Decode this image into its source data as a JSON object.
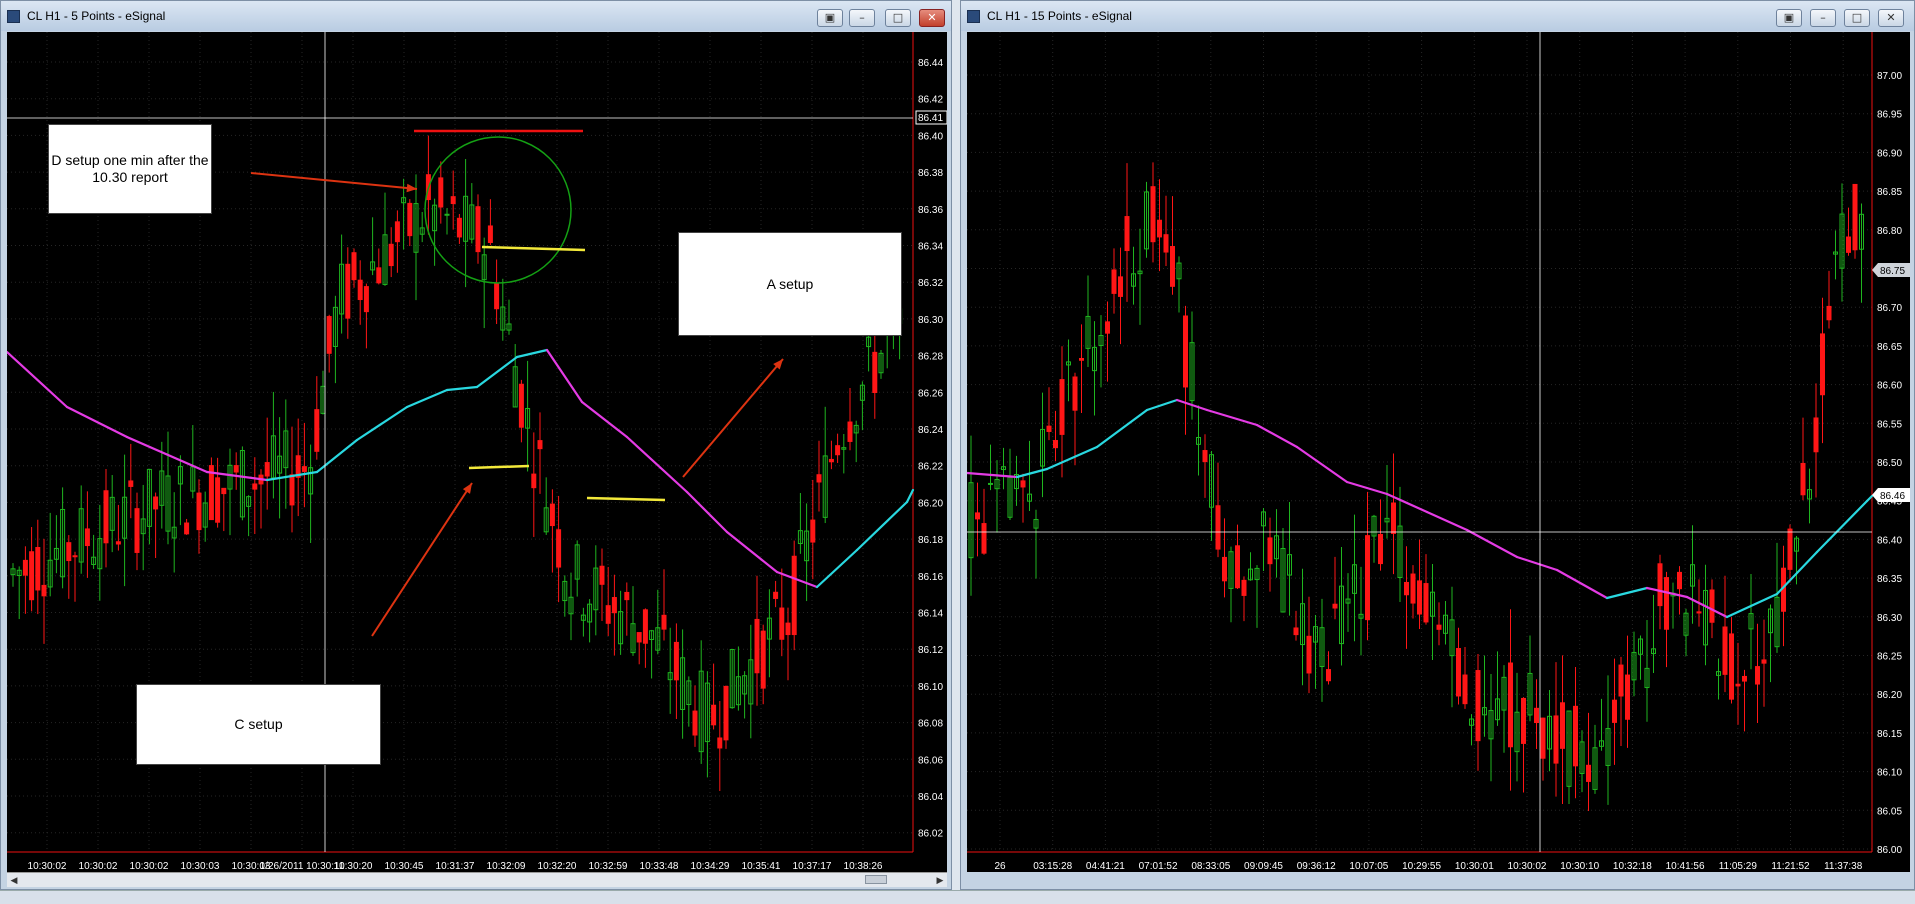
{
  "windows": {
    "left": {
      "title": "CL H1 - 5 Points - eSignal"
    },
    "right": {
      "title": "CL H1 - 15 Points - eSignal"
    }
  },
  "colors": {
    "bull": "#1fb51f",
    "bear": "#ff1616",
    "ma_up": "#29d8e0",
    "ma_down": "#e43be4",
    "bg": "#000000",
    "grid": "#262626",
    "axis_text": "#ffffff",
    "annotation_yellow": "#f3e93a",
    "annotation_red": "#e11",
    "circle": "#14a014"
  },
  "left_chart": {
    "y_labels": [
      "86.44",
      "86.42",
      "86.40",
      "86.38",
      "86.36",
      "86.34",
      "86.32",
      "86.30",
      "86.28",
      "86.26",
      "86.24",
      "86.22",
      "86.20",
      "86.18",
      "86.16",
      "86.14",
      "86.12",
      "86.10",
      "86.08",
      "86.06",
      "86.04",
      "86.02"
    ],
    "current_price": "86.41",
    "x_labels": [
      "10:30:02",
      "10:30:02",
      "10:30:02",
      "10:30:03",
      "10:30:03",
      "1/26/2011 10:30:11",
      "10:30:20",
      "10:30:45",
      "10:31:37",
      "10:32:09",
      "10:32:20",
      "10:32:59",
      "10:33:48",
      "10:34:29",
      "10:35:41",
      "10:37:17",
      "10:38:26"
    ],
    "notes": {
      "d_setup": "D setup one min after the 10.30 report",
      "a_setup": "A setup",
      "c_setup": "C setup"
    }
  },
  "right_chart": {
    "y_labels": [
      "87.00",
      "86.95",
      "86.90",
      "86.85",
      "86.80",
      "86.75",
      "86.70",
      "86.65",
      "86.60",
      "86.55",
      "86.50",
      "86.45",
      "86.40",
      "86.35",
      "86.30",
      "86.25",
      "86.20",
      "86.15",
      "86.10",
      "86.05",
      "86.00"
    ],
    "price_marker_top": "86.75",
    "price_marker_bottom": "86.46",
    "x_labels": [
      "26",
      "03:15:28",
      "04:41:21",
      "07:01:52",
      "08:33:05",
      "09:09:45",
      "09:36:12",
      "10:07:05",
      "10:29:55",
      "10:30:01",
      "10:30:02",
      "10:30:10",
      "10:32:18",
      "10:41:56",
      "11:05:29",
      "11:21:52",
      "11:37:38"
    ]
  }
}
